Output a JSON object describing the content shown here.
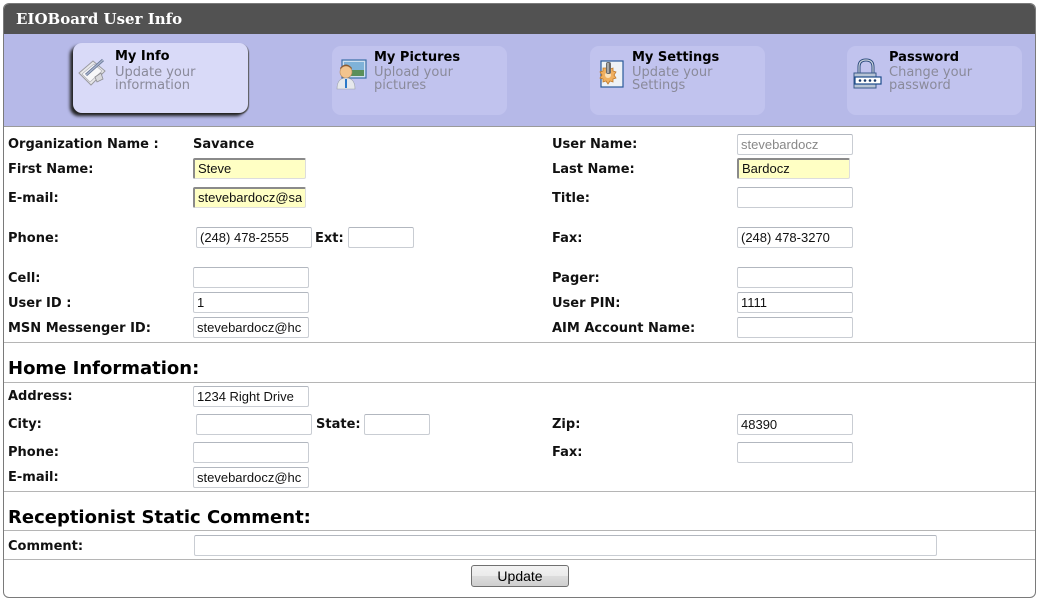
{
  "window": {
    "title": "EIOBoard User Info"
  },
  "nav": {
    "tabs": [
      {
        "id": "my-info",
        "title": "My Info",
        "subtitle": "Update your information",
        "icon": "notepad-pencil-icon",
        "active": true
      },
      {
        "id": "my-pictures",
        "title": "My Pictures",
        "subtitle": "Upload your pictures",
        "icon": "user-pictures-icon",
        "active": false
      },
      {
        "id": "my-settings",
        "title": "My Settings",
        "subtitle": "Update your Settings",
        "icon": "settings-gear-icon",
        "active": false
      },
      {
        "id": "password",
        "title": "Password",
        "subtitle": "Change your password",
        "icon": "padlock-icon",
        "active": false
      }
    ]
  },
  "user_info": {
    "org_label": "Organization Name :",
    "org_value": "Savance",
    "user_name_label": "User Name:",
    "user_name_value": "stevebardocz",
    "first_name_label": "First Name:",
    "first_name_value": "Steve",
    "last_name_label": "Last Name:",
    "last_name_value": "Bardocz",
    "email_label": "E-mail:",
    "email_value": "stevebardocz@sa",
    "title_label": "Title:",
    "title_value": "",
    "phone_label": "Phone:",
    "phone_value": "(248) 478-2555",
    "ext_label": "Ext:",
    "ext_value": "",
    "fax_label": "Fax:",
    "fax_value": "(248) 478-3270",
    "cell_label": "Cell:",
    "cell_value": "",
    "pager_label": "Pager:",
    "pager_value": "",
    "user_id_label": "User ID :",
    "user_id_value": "1",
    "user_pin_label": "User PIN:",
    "user_pin_value": "1111",
    "msn_label": "MSN Messenger ID:",
    "msn_value": "stevebardocz@hc",
    "aim_label": "AIM Account Name:",
    "aim_value": ""
  },
  "home_info": {
    "heading": "Home Information:",
    "address_label": "Address:",
    "address_value": "1234 Right Drive",
    "city_label": "City:",
    "city_value": "",
    "state_label": "State:",
    "state_value": "",
    "zip_label": "Zip:",
    "zip_value": "48390",
    "phone_label": "Phone:",
    "phone_value": "",
    "fax_label": "Fax:",
    "fax_value": "",
    "email_label": "E-mail:",
    "email_value": "stevebardocz@hc"
  },
  "comment": {
    "heading": "Receptionist Static Comment:",
    "label": "Comment:",
    "value": ""
  },
  "actions": {
    "update_label": "Update"
  }
}
